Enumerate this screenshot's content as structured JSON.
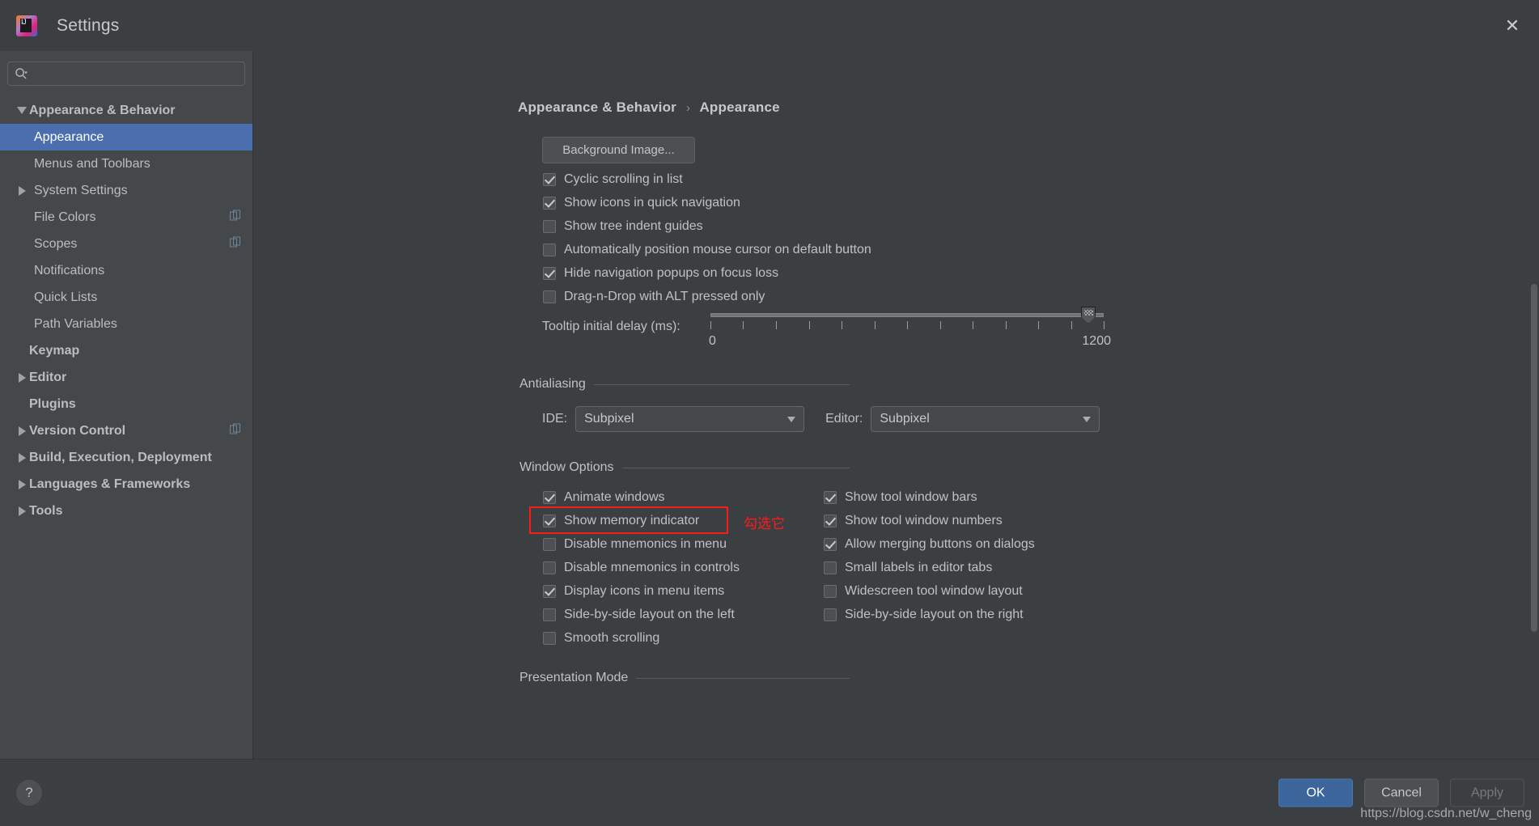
{
  "window": {
    "title": "Settings",
    "logo_icon": "intellij-idea-logo",
    "close_icon": "close-icon"
  },
  "sidebar": {
    "search": {
      "placeholder": "",
      "value": "",
      "icon": "search-icon"
    },
    "items": [
      {
        "label": "Appearance & Behavior",
        "level": 0,
        "twisty": "expanded",
        "selected": false,
        "badge": false
      },
      {
        "label": "Appearance",
        "level": 1,
        "twisty": "none",
        "selected": true,
        "badge": false
      },
      {
        "label": "Menus and Toolbars",
        "level": 1,
        "twisty": "none",
        "selected": false,
        "badge": false
      },
      {
        "label": "System Settings",
        "level": 1,
        "twisty": "collapsed",
        "selected": false,
        "badge": false
      },
      {
        "label": "File Colors",
        "level": 1,
        "twisty": "none",
        "selected": false,
        "badge": true
      },
      {
        "label": "Scopes",
        "level": 1,
        "twisty": "none",
        "selected": false,
        "badge": true
      },
      {
        "label": "Notifications",
        "level": 1,
        "twisty": "none",
        "selected": false,
        "badge": false
      },
      {
        "label": "Quick Lists",
        "level": 1,
        "twisty": "none",
        "selected": false,
        "badge": false
      },
      {
        "label": "Path Variables",
        "level": 1,
        "twisty": "none",
        "selected": false,
        "badge": false
      },
      {
        "label": "Keymap",
        "level": 0,
        "twisty": "none",
        "selected": false,
        "badge": false
      },
      {
        "label": "Editor",
        "level": 0,
        "twisty": "collapsed",
        "selected": false,
        "badge": false
      },
      {
        "label": "Plugins",
        "level": 0,
        "twisty": "none",
        "selected": false,
        "badge": false
      },
      {
        "label": "Version Control",
        "level": 0,
        "twisty": "collapsed",
        "selected": false,
        "badge": true
      },
      {
        "label": "Build, Execution, Deployment",
        "level": 0,
        "twisty": "collapsed",
        "selected": false,
        "badge": false
      },
      {
        "label": "Languages & Frameworks",
        "level": 0,
        "twisty": "collapsed",
        "selected": false,
        "badge": false
      },
      {
        "label": "Tools",
        "level": 0,
        "twisty": "collapsed",
        "selected": false,
        "badge": false
      }
    ]
  },
  "content": {
    "breadcrumb": {
      "root": "Appearance & Behavior",
      "separator": "›",
      "leaf": "Appearance"
    },
    "background_image_button": "Background Image...",
    "top_checkboxes": [
      {
        "label": "Cyclic scrolling in list",
        "checked": true
      },
      {
        "label": "Show icons in quick navigation",
        "checked": true
      },
      {
        "label": "Show tree indent guides",
        "checked": false
      },
      {
        "label": "Automatically position mouse cursor on default button",
        "checked": false
      },
      {
        "label": "Hide navigation popups on focus loss",
        "checked": true
      },
      {
        "label": "Drag-n-Drop with ALT pressed only",
        "checked": false
      }
    ],
    "tooltip_slider": {
      "label": "Tooltip initial delay (ms):",
      "min_label": "0",
      "max_label": "1200",
      "min": 0,
      "max": 1200,
      "value": 1200,
      "tick_count": 13
    },
    "antialiasing": {
      "group_title": "Antialiasing",
      "ide_label": "IDE:",
      "ide_value": "Subpixel",
      "editor_label": "Editor:",
      "editor_value": "Subpixel"
    },
    "window_options": {
      "group_title": "Window Options",
      "left_column": [
        {
          "label": "Animate windows",
          "checked": true
        },
        {
          "label": "Show memory indicator",
          "checked": true
        },
        {
          "label": "Disable mnemonics in menu",
          "checked": false
        },
        {
          "label": "Disable mnemonics in controls",
          "checked": false
        },
        {
          "label": "Display icons in menu items",
          "checked": true
        },
        {
          "label": "Side-by-side layout on the left",
          "checked": false
        },
        {
          "label": "Smooth scrolling",
          "checked": false
        }
      ],
      "right_column": [
        {
          "label": "Show tool window bars",
          "checked": true
        },
        {
          "label": "Show tool window numbers",
          "checked": true
        },
        {
          "label": "Allow merging buttons on dialogs",
          "checked": true
        },
        {
          "label": "Small labels in editor tabs",
          "checked": false
        },
        {
          "label": "Widescreen tool window layout",
          "checked": false
        },
        {
          "label": "Side-by-side layout on the right",
          "checked": false
        }
      ]
    },
    "presentation_mode": {
      "group_title": "Presentation Mode"
    }
  },
  "annotation": {
    "text": "勾选它",
    "color": "#ff1a1a",
    "target": "Show memory indicator"
  },
  "footer": {
    "help_icon": "question-mark-icon",
    "ok": "OK",
    "cancel": "Cancel",
    "apply": "Apply",
    "apply_disabled": true
  },
  "watermark": "https://blog.csdn.net/w_cheng"
}
